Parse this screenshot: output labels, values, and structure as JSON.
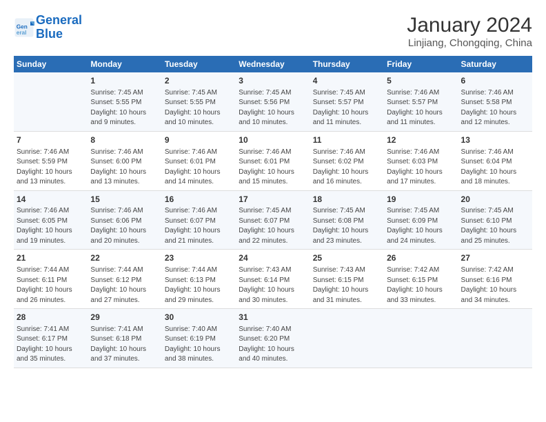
{
  "logo": {
    "line1": "General",
    "line2": "Blue"
  },
  "title": "January 2024",
  "subtitle": "Linjiang, Chongqing, China",
  "columns": [
    "Sunday",
    "Monday",
    "Tuesday",
    "Wednesday",
    "Thursday",
    "Friday",
    "Saturday"
  ],
  "weeks": [
    [
      {
        "day": "",
        "content": ""
      },
      {
        "day": "1",
        "content": "Sunrise: 7:45 AM\nSunset: 5:55 PM\nDaylight: 10 hours\nand 9 minutes."
      },
      {
        "day": "2",
        "content": "Sunrise: 7:45 AM\nSunset: 5:55 PM\nDaylight: 10 hours\nand 10 minutes."
      },
      {
        "day": "3",
        "content": "Sunrise: 7:45 AM\nSunset: 5:56 PM\nDaylight: 10 hours\nand 10 minutes."
      },
      {
        "day": "4",
        "content": "Sunrise: 7:45 AM\nSunset: 5:57 PM\nDaylight: 10 hours\nand 11 minutes."
      },
      {
        "day": "5",
        "content": "Sunrise: 7:46 AM\nSunset: 5:57 PM\nDaylight: 10 hours\nand 11 minutes."
      },
      {
        "day": "6",
        "content": "Sunrise: 7:46 AM\nSunset: 5:58 PM\nDaylight: 10 hours\nand 12 minutes."
      }
    ],
    [
      {
        "day": "7",
        "content": "Sunrise: 7:46 AM\nSunset: 5:59 PM\nDaylight: 10 hours\nand 13 minutes."
      },
      {
        "day": "8",
        "content": "Sunrise: 7:46 AM\nSunset: 6:00 PM\nDaylight: 10 hours\nand 13 minutes."
      },
      {
        "day": "9",
        "content": "Sunrise: 7:46 AM\nSunset: 6:01 PM\nDaylight: 10 hours\nand 14 minutes."
      },
      {
        "day": "10",
        "content": "Sunrise: 7:46 AM\nSunset: 6:01 PM\nDaylight: 10 hours\nand 15 minutes."
      },
      {
        "day": "11",
        "content": "Sunrise: 7:46 AM\nSunset: 6:02 PM\nDaylight: 10 hours\nand 16 minutes."
      },
      {
        "day": "12",
        "content": "Sunrise: 7:46 AM\nSunset: 6:03 PM\nDaylight: 10 hours\nand 17 minutes."
      },
      {
        "day": "13",
        "content": "Sunrise: 7:46 AM\nSunset: 6:04 PM\nDaylight: 10 hours\nand 18 minutes."
      }
    ],
    [
      {
        "day": "14",
        "content": "Sunrise: 7:46 AM\nSunset: 6:05 PM\nDaylight: 10 hours\nand 19 minutes."
      },
      {
        "day": "15",
        "content": "Sunrise: 7:46 AM\nSunset: 6:06 PM\nDaylight: 10 hours\nand 20 minutes."
      },
      {
        "day": "16",
        "content": "Sunrise: 7:46 AM\nSunset: 6:07 PM\nDaylight: 10 hours\nand 21 minutes."
      },
      {
        "day": "17",
        "content": "Sunrise: 7:45 AM\nSunset: 6:07 PM\nDaylight: 10 hours\nand 22 minutes."
      },
      {
        "day": "18",
        "content": "Sunrise: 7:45 AM\nSunset: 6:08 PM\nDaylight: 10 hours\nand 23 minutes."
      },
      {
        "day": "19",
        "content": "Sunrise: 7:45 AM\nSunset: 6:09 PM\nDaylight: 10 hours\nand 24 minutes."
      },
      {
        "day": "20",
        "content": "Sunrise: 7:45 AM\nSunset: 6:10 PM\nDaylight: 10 hours\nand 25 minutes."
      }
    ],
    [
      {
        "day": "21",
        "content": "Sunrise: 7:44 AM\nSunset: 6:11 PM\nDaylight: 10 hours\nand 26 minutes."
      },
      {
        "day": "22",
        "content": "Sunrise: 7:44 AM\nSunset: 6:12 PM\nDaylight: 10 hours\nand 27 minutes."
      },
      {
        "day": "23",
        "content": "Sunrise: 7:44 AM\nSunset: 6:13 PM\nDaylight: 10 hours\nand 29 minutes."
      },
      {
        "day": "24",
        "content": "Sunrise: 7:43 AM\nSunset: 6:14 PM\nDaylight: 10 hours\nand 30 minutes."
      },
      {
        "day": "25",
        "content": "Sunrise: 7:43 AM\nSunset: 6:15 PM\nDaylight: 10 hours\nand 31 minutes."
      },
      {
        "day": "26",
        "content": "Sunrise: 7:42 AM\nSunset: 6:15 PM\nDaylight: 10 hours\nand 33 minutes."
      },
      {
        "day": "27",
        "content": "Sunrise: 7:42 AM\nSunset: 6:16 PM\nDaylight: 10 hours\nand 34 minutes."
      }
    ],
    [
      {
        "day": "28",
        "content": "Sunrise: 7:41 AM\nSunset: 6:17 PM\nDaylight: 10 hours\nand 35 minutes."
      },
      {
        "day": "29",
        "content": "Sunrise: 7:41 AM\nSunset: 6:18 PM\nDaylight: 10 hours\nand 37 minutes."
      },
      {
        "day": "30",
        "content": "Sunrise: 7:40 AM\nSunset: 6:19 PM\nDaylight: 10 hours\nand 38 minutes."
      },
      {
        "day": "31",
        "content": "Sunrise: 7:40 AM\nSunset: 6:20 PM\nDaylight: 10 hours\nand 40 minutes."
      },
      {
        "day": "",
        "content": ""
      },
      {
        "day": "",
        "content": ""
      },
      {
        "day": "",
        "content": ""
      }
    ]
  ]
}
